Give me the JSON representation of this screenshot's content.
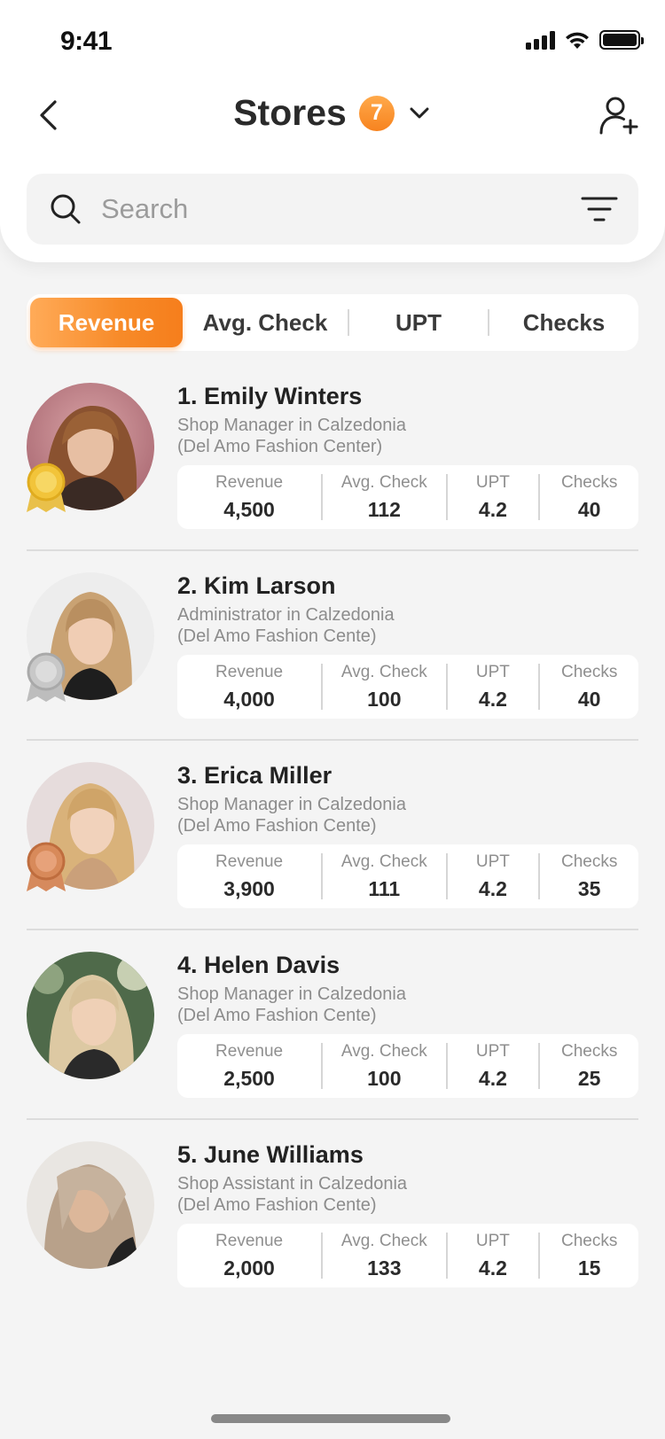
{
  "status_bar": {
    "time": "9:41"
  },
  "header": {
    "title": "Stores",
    "badge_count": "7",
    "icons": [
      "chevron-left-icon",
      "chevron-down-icon",
      "add-user-icon"
    ]
  },
  "search": {
    "placeholder": "Search",
    "value": ""
  },
  "tabs": [
    {
      "label": "Revenue",
      "active": true
    },
    {
      "label": "Avg. Check",
      "active": false
    },
    {
      "label": "UPT",
      "active": false
    },
    {
      "label": "Checks",
      "active": false
    }
  ],
  "stat_labels": {
    "revenue": "Revenue",
    "avg_check": "Avg. Check",
    "upt": "UPT",
    "checks": "Checks"
  },
  "colors": {
    "accent": "#f7831f",
    "accent_light": "#ffab58",
    "gold": "#f2c43a",
    "silver": "#c8c8c8",
    "bronze": "#d88a5a"
  },
  "employees": [
    {
      "name": "1. Emily Winters",
      "role_line1": "Shop Manager in Calzedonia",
      "role_line2": "(Del Amo Fashion Center)",
      "medal": "gold",
      "revenue": "4,500",
      "avg_check": "112",
      "upt": "4.2",
      "checks": "40"
    },
    {
      "name": "2. Kim Larson",
      "role_line1": "Administrator in Calzedonia",
      "role_line2": "(Del Amo Fashion Cente)",
      "medal": "silver",
      "revenue": "4,000",
      "avg_check": "100",
      "upt": "4.2",
      "checks": "40"
    },
    {
      "name": "3. Erica Miller",
      "role_line1": "Shop Manager in Calzedonia",
      "role_line2": "(Del Amo Fashion Cente)",
      "medal": "bronze",
      "revenue": "3,900",
      "avg_check": "111",
      "upt": "4.2",
      "checks": "35"
    },
    {
      "name": "4. Helen Davis",
      "role_line1": "Shop Manager in Calzedonia",
      "role_line2": "(Del Amo Fashion Cente)",
      "medal": "",
      "revenue": "2,500",
      "avg_check": "100",
      "upt": "4.2",
      "checks": "25"
    },
    {
      "name": "5. June Williams",
      "role_line1": "Shop Assistant in Calzedonia",
      "role_line2": "(Del Amo Fashion Cente)",
      "medal": "",
      "revenue": "2,000",
      "avg_check": "133",
      "upt": "4.2",
      "checks": "15"
    }
  ]
}
